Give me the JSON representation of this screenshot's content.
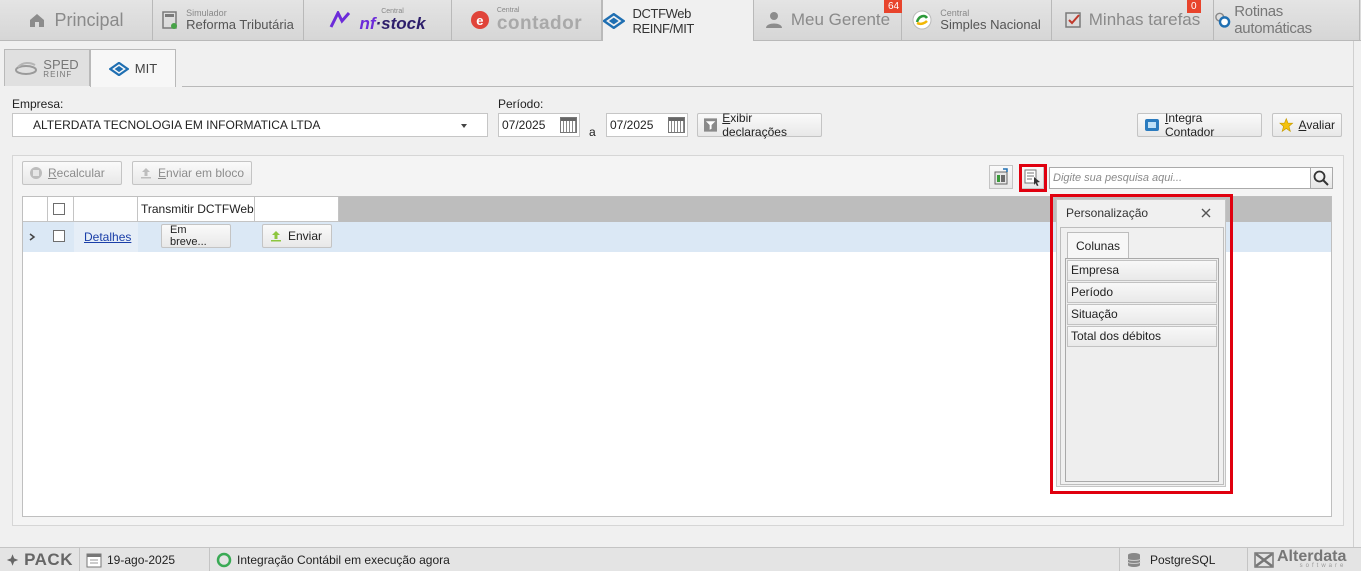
{
  "top_tabs": [
    {
      "label": "Principal"
    },
    {
      "small": "Simulador",
      "label": "Reforma Tributária"
    },
    {
      "small": "Central",
      "label_a": "nf",
      "label_b": "·stock"
    },
    {
      "small": "Central",
      "label": "contador"
    },
    {
      "label": "DCTFWeb REINF/MIT",
      "active": true
    },
    {
      "label": "Meu Gerente",
      "badge": "64"
    },
    {
      "small": "Central",
      "label": "Simples Nacional"
    },
    {
      "label": "Minhas tarefas",
      "badge": "0"
    },
    {
      "label": "Rotinas automáticas"
    }
  ],
  "sub_tabs": [
    {
      "label": "SPED",
      "sub": "REINF"
    },
    {
      "label": "MIT",
      "active": true
    }
  ],
  "form": {
    "empresa_label": "Empresa:",
    "empresa_value": "ALTERDATA TECNOLOGIA EM INFORMATICA LTDA",
    "periodo_label": "Período:",
    "periodo_from": "07/2025",
    "periodo_sep": "a",
    "periodo_to": "07/2025",
    "exibir_label_first": "E",
    "exibir_label_rest": "xibir declarações",
    "integra_label_first": "I",
    "integra_label_rest": "ntegra Contador",
    "avaliar_label_first": "A",
    "avaliar_label_rest": "valiar"
  },
  "toolbar": {
    "recalcular_first": "R",
    "recalcular_rest": "ecalcular",
    "enviar_bloco_first": "E",
    "enviar_bloco_rest": "nviar em bloco",
    "search_placeholder": "Digite sua pesquisa aqui..."
  },
  "grid": {
    "header_transmitir": "Transmitir DCTFWeb",
    "row": {
      "detalhes": "Detalhes",
      "em_breve": "Em breve...",
      "enviar": "Enviar"
    }
  },
  "personalizacao": {
    "title": "Personalização",
    "tab": "Colunas",
    "columns": [
      "Empresa",
      "Período",
      "Situação",
      "Total dos débitos"
    ]
  },
  "statusbar": {
    "pack": "PACK",
    "date": "19-ago-2025",
    "status": "Integração Contábil em execução agora",
    "db": "PostgreSQL",
    "brand": "Alterdata",
    "brand_sub": "software"
  },
  "colors": {
    "highlight_red": "#e0000f",
    "badge": "#e8442c",
    "link": "#1a3ea8",
    "row_selected": "#dbe8f5"
  }
}
